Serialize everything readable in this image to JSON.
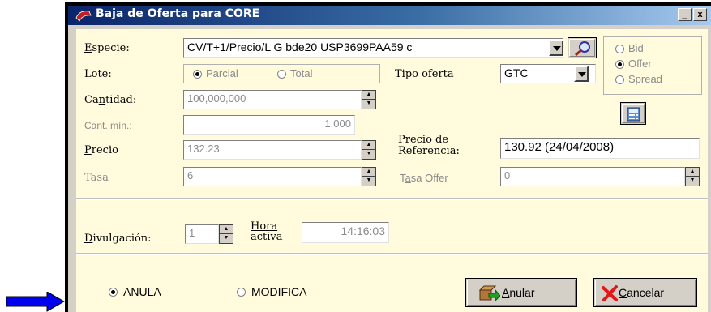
{
  "window": {
    "title": "Baja de Oferta para CORE",
    "minimize": "_",
    "close": "x"
  },
  "especie": {
    "label": "Especie:",
    "value": "CV/T+1/Precio/L G bde20 USP3699PAA59 c"
  },
  "lote": {
    "label": "Lote:",
    "options": [
      "Parcial",
      "Total"
    ],
    "selected": "Parcial"
  },
  "tipo_oferta": {
    "label": "Tipo oferta",
    "value": "GTC"
  },
  "side": {
    "options": [
      "Bid",
      "Offer",
      "Spread"
    ],
    "selected": "Offer"
  },
  "cantidad": {
    "label": "Cantidad:",
    "value": "100,000,000"
  },
  "cant_min": {
    "label": "Cant. mín.:",
    "value": "1,000"
  },
  "precio": {
    "label": "Precio",
    "value": "132.23"
  },
  "precio_ref": {
    "label_line1": "Precio de",
    "label_line2": "Referencia:",
    "value": "130.92 (24/04/2008)"
  },
  "tasa": {
    "label": "Tasa",
    "value": "6"
  },
  "tasa_offer": {
    "label": "Tasa Offer",
    "value": "0"
  },
  "divulgacion": {
    "label": "Divulgación:",
    "value": "1"
  },
  "hora_activa": {
    "label_line1": "Hora",
    "label_line2": "activa",
    "value": "14:16:03"
  },
  "action": {
    "options": [
      "ANULA",
      "MODIFICA"
    ],
    "selected": "ANULA"
  },
  "buttons": {
    "anular": "Anular",
    "cancelar": "Cancelar"
  },
  "colors": {
    "panel": "#fffbdc",
    "title_start": "#0a246a",
    "title_end": "#a6caf0",
    "arrow": "#0000ee"
  }
}
